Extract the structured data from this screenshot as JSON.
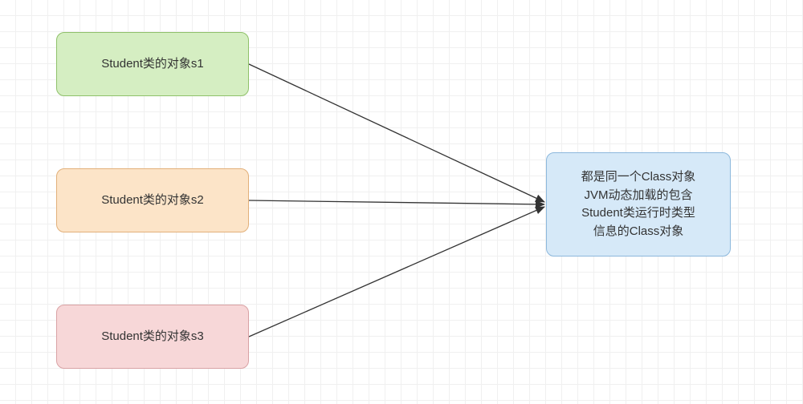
{
  "nodes": {
    "s1": {
      "label": "Student类的对象s1"
    },
    "s2": {
      "label": "Student类的对象s2"
    },
    "s3": {
      "label": "Student类的对象s3"
    },
    "classObj": {
      "line1": "都是同一个Class对象",
      "line2": "JVM动态加载的包含",
      "line3": "Student类运行时类型",
      "line4": "信息的Class对象"
    }
  },
  "chart_data": {
    "type": "diagram",
    "title": "",
    "nodes": [
      {
        "id": "s1",
        "label": "Student类的对象s1",
        "color": "#d5eec2"
      },
      {
        "id": "s2",
        "label": "Student类的对象s2",
        "color": "#fce4c8"
      },
      {
        "id": "s3",
        "label": "Student类的对象s3",
        "color": "#f7d7d8"
      },
      {
        "id": "classObj",
        "label": "都是同一个Class对象 JVM动态加载的包含Student类运行时类型信息的Class对象",
        "color": "#d6e9f8"
      }
    ],
    "edges": [
      {
        "from": "s1",
        "to": "classObj"
      },
      {
        "from": "s2",
        "to": "classObj"
      },
      {
        "from": "s3",
        "to": "classObj"
      }
    ]
  }
}
